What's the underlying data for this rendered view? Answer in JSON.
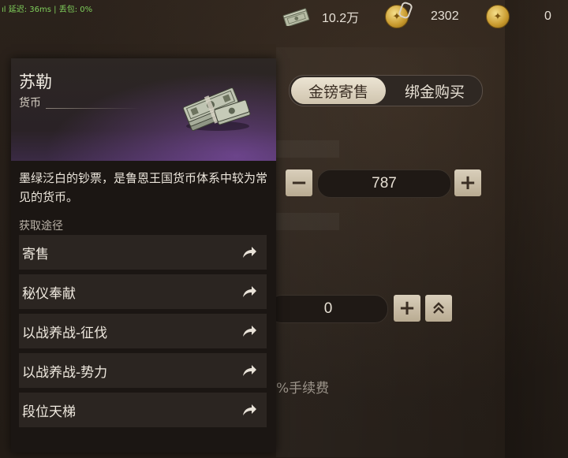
{
  "status": {
    "signal": "ıl",
    "latency": "延迟: 36ms",
    "separator": "|",
    "packet_loss": "丢包: 0%"
  },
  "currencies": [
    {
      "icon": "cash-stack-icon",
      "value": "10.2万"
    },
    {
      "icon": "bound-gold-coin-icon",
      "value": "2302"
    },
    {
      "icon": "gold-coin-icon",
      "value": "0"
    }
  ],
  "tabs": [
    {
      "label": "金镑寄售",
      "active": true
    },
    {
      "label": "绑金购买",
      "active": false
    }
  ],
  "quantity": {
    "value": "787",
    "minus": "−",
    "plus": "+"
  },
  "price": {
    "value": "0",
    "plus": "+",
    "max": "⌃⌃"
  },
  "fee_text": "%手续费",
  "item": {
    "name": "苏勒",
    "type": "货币",
    "description": "墨绿泛白的钞票，是鲁恩王国货币体系中较为常见的货币。",
    "source_title": "获取途径",
    "routes": [
      "寄售",
      "秘仪奉献",
      "以战养战-征伐",
      "以战养战-势力",
      "段位天梯"
    ]
  },
  "colors": {
    "accent_gold": "#c89a2e",
    "button_cream": "#d9cfbb",
    "net_green": "#7fcf5b",
    "rarity_purple": "#8a5ac8"
  }
}
